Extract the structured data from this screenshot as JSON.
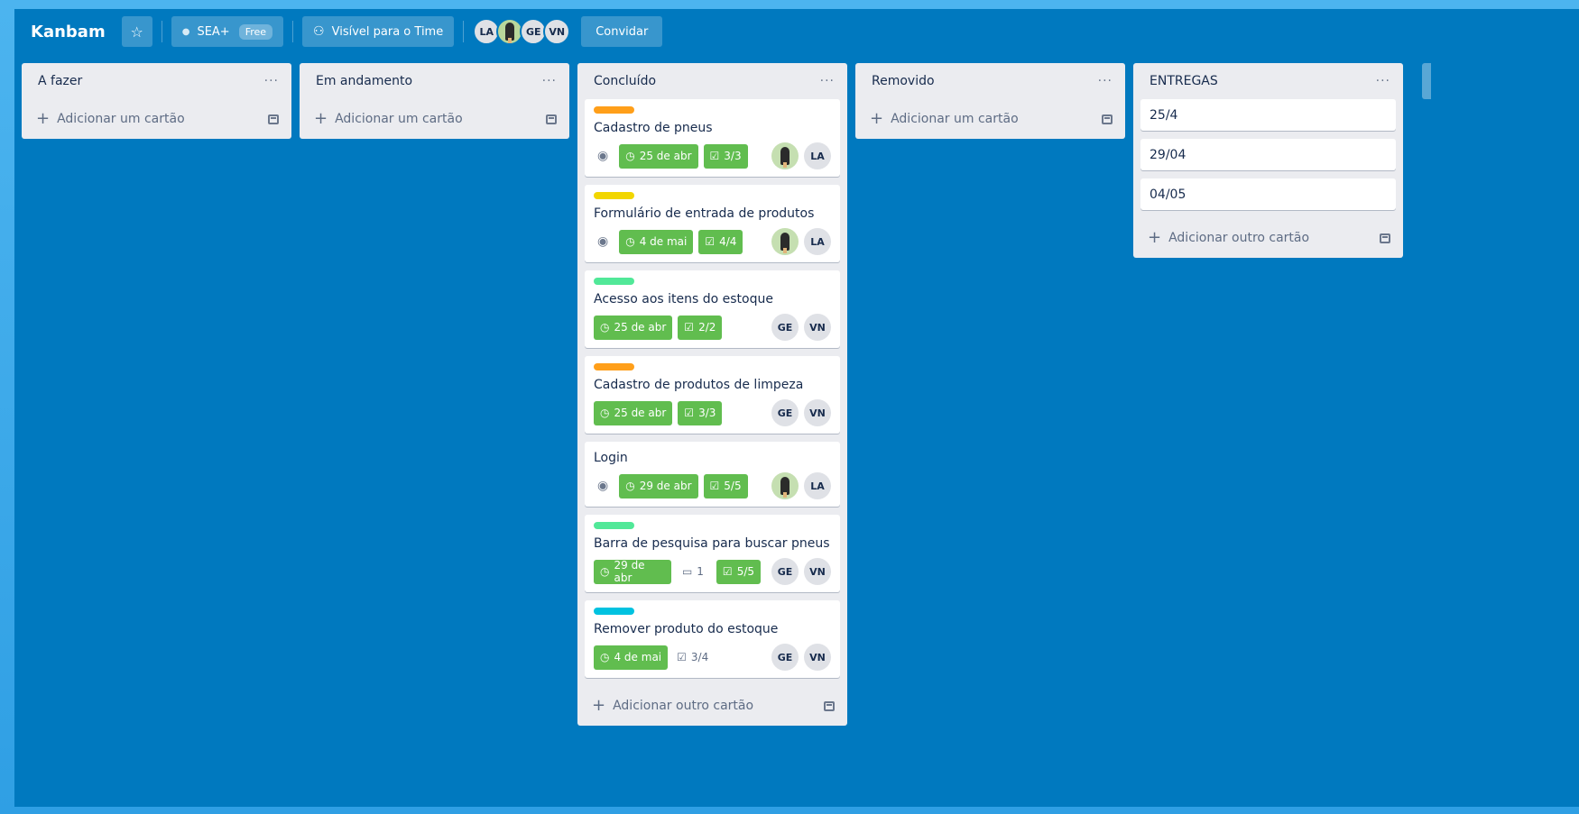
{
  "header": {
    "board_title": "Kanbam",
    "star_icon": "star-icon",
    "workspace_label": "SEA+",
    "workspace_badge": "Free",
    "visibility_label": "Visível para o Time",
    "visibility_icon": "team-icon",
    "members": [
      "LA",
      "",
      "GE",
      "VN"
    ],
    "invite_label": "Convidar"
  },
  "labels_colors": {
    "orange": "#ff9f1a",
    "yellow": "#f2d600",
    "green": "#51e898",
    "sky": "#00c2e0",
    "badge_green": "#61bd4f",
    "board_blue": "#0079bf"
  },
  "lists": [
    {
      "title": "A fazer",
      "menu": "···",
      "add_label": "Adicionar um cartão"
    },
    {
      "title": "Em andamento",
      "menu": "···",
      "add_label": "Adicionar um cartão"
    },
    {
      "title": "Concluído",
      "menu": "···",
      "add_label": "Adicionar outro cartão",
      "cards": [
        {
          "label_color": "orange",
          "title": "Cadastro de pneus",
          "watch": true,
          "due": "25 de abr",
          "checklist": "3/3",
          "members": [
            "photo",
            "LA"
          ]
        },
        {
          "label_color": "yellow",
          "title": "Formulário de entrada de produtos",
          "watch": true,
          "due": "4 de mai",
          "checklist": "4/4",
          "members": [
            "photo",
            "LA"
          ]
        },
        {
          "label_color": "green",
          "title": "Acesso aos itens do estoque",
          "watch": false,
          "due": "25 de abr",
          "checklist": "2/2",
          "members": [
            "GE",
            "VN"
          ]
        },
        {
          "label_color": "orange",
          "title": "Cadastro de produtos de limpeza",
          "watch": false,
          "due": "25 de abr",
          "checklist": "3/3",
          "members": [
            "GE",
            "VN"
          ]
        },
        {
          "label_color": "",
          "title": "Login",
          "watch": true,
          "due": "29 de abr",
          "checklist": "5/5",
          "members": [
            "photo",
            "LA"
          ]
        },
        {
          "label_color": "green",
          "title": "Barra de pesquisa para buscar pneus",
          "watch": false,
          "due": "29 de abr",
          "comments": "1",
          "checklist": "5/5",
          "members": [
            "GE",
            "VN"
          ]
        },
        {
          "label_color": "sky",
          "title": "Remover produto do estoque",
          "watch": false,
          "due": "4 de mai",
          "checklist": "3/4",
          "checklist_incomplete": true,
          "members": [
            "GE",
            "VN"
          ]
        }
      ]
    },
    {
      "title": "Removido",
      "menu": "···",
      "add_label": "Adicionar um cartão"
    },
    {
      "title": "ENTREGAS",
      "menu": "···",
      "add_label": "Adicionar outro cartão",
      "simple_cards": [
        "25/4",
        "29/04",
        "04/05"
      ]
    }
  ]
}
